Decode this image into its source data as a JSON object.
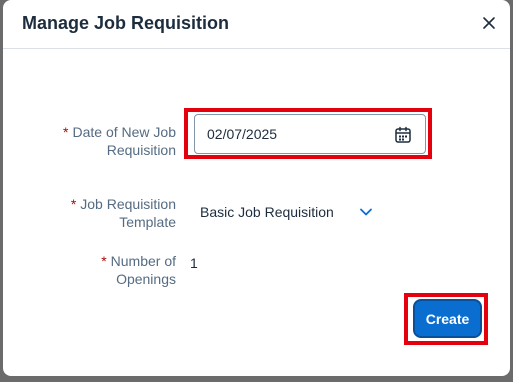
{
  "dialog": {
    "title": "Manage Job Requisition",
    "close_icon": "close-icon"
  },
  "form": {
    "date": {
      "required_mark": "*",
      "label_line1": "Date of New Job",
      "label_line2": "Requisition",
      "value": "02/07/2025",
      "icon": "calendar-icon"
    },
    "template": {
      "required_mark": "*",
      "label_line1": "Job Requisition",
      "label_line2": "Template",
      "value": "Basic Job Requisition",
      "icon": "chevron-down-icon"
    },
    "openings": {
      "required_mark": "*",
      "label_line1": "Number of",
      "label_line2": "Openings",
      "value": "1"
    }
  },
  "actions": {
    "create_label": "Create"
  },
  "colors": {
    "accent": "#0a6ed1",
    "highlight": "#e4000c",
    "required": "#aa0808"
  }
}
